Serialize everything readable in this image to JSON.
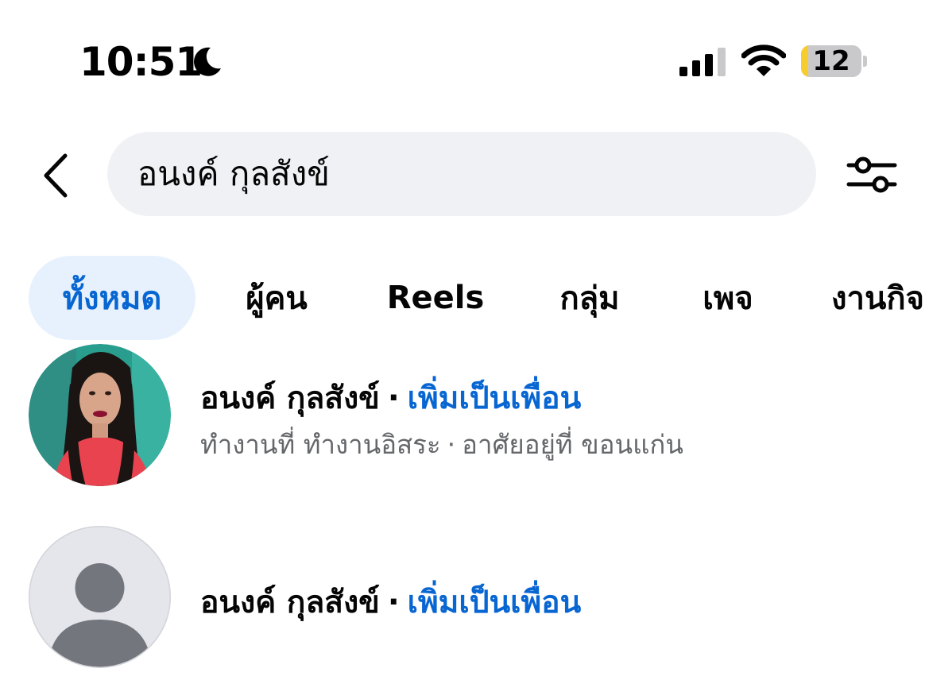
{
  "status_bar": {
    "time": "10:51",
    "battery_level": "12",
    "battery_fraction": 0.12,
    "icons": [
      "moon-icon",
      "cellular-signal-icon",
      "wifi-icon",
      "battery-icon"
    ]
  },
  "search": {
    "query": "อนงค์ กุลสังข์",
    "back_icon": "chevron-left-icon",
    "filter_icon": "filter-sliders-icon"
  },
  "tabs": [
    {
      "label": "ทั้งหมด",
      "active": true
    },
    {
      "label": "ผู้คน",
      "active": false
    },
    {
      "label": "Reels",
      "active": false
    },
    {
      "label": "กลุ่ม",
      "active": false
    },
    {
      "label": "เพจ",
      "active": false
    },
    {
      "label": "งานกิจ",
      "active": false
    }
  ],
  "results": [
    {
      "name": "อนงค์ กุลสังข์",
      "separator": "·",
      "action": "เพิ่มเป็นเพื่อน",
      "work": "ทำงานที่ ทำงานอิสระ",
      "meta_separator": "·",
      "location": "อาศัยอยู่ที่ ขอนแก่น",
      "avatar": "profile-photo"
    },
    {
      "name": "อนงค์ กุลสังข์",
      "separator": "·",
      "action": "เพิ่มเป็นเพื่อน",
      "avatar": "default-avatar-icon"
    }
  ],
  "colors": {
    "accent": "#0866d2",
    "active_tab_bg": "#e7f1fd",
    "search_bg": "#eff1f4",
    "secondary_text": "#65676b",
    "battery_fill": "#f7cd2e"
  }
}
